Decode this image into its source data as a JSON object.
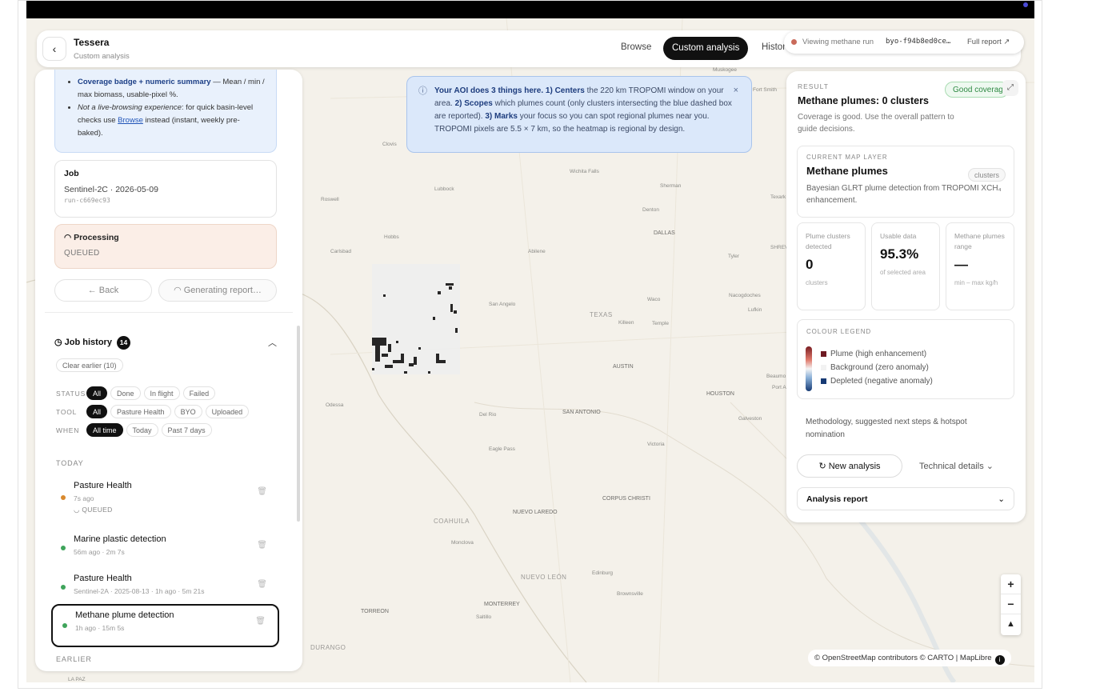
{
  "header": {
    "app_title": "Tessera",
    "app_subtitle": "Custom analysis",
    "nav_browse": "Browse",
    "nav_custom": "Custom analysis",
    "nav_history": "Histor",
    "run_label": "Viewing methane run",
    "run_id": "byo-f94b8ed0ce…",
    "full_report": "Full report ↗"
  },
  "left": {
    "info_line1_bold": "Coverage badge + numeric summary",
    "info_line1_rest": " — Mean / min / max biomass, usable-pixel %.",
    "info_line2_italic": "Not a live-browsing experience",
    "info_line2_rest": ": for quick basin-level checks use ",
    "info_line2_link": "Browse",
    "info_line2_tail": " instead (instant, weekly pre-baked).",
    "job_title": "Job",
    "job_sensor_date": "Sentinel-2C · 2026-05-09",
    "job_run": "run-c669ec93",
    "processing_title": "Processing",
    "processing_status": "QUEUED",
    "back_label": "← Back",
    "generating_label": "Generating report…",
    "history_title": "Job history",
    "history_count": "14",
    "clear_label": "Clear earlier (10)",
    "filters": {
      "status_label": "STATUS",
      "status": [
        "All",
        "Done",
        "In flight",
        "Failed"
      ],
      "tool_label": "TOOL",
      "tool": [
        "All",
        "Pasture Health",
        "BYO",
        "Uploaded"
      ],
      "when_label": "WHEN",
      "when": [
        "All time",
        "Today",
        "Past 7 days"
      ]
    },
    "section_today": "TODAY",
    "section_earlier": "EARLIER",
    "items": [
      {
        "name": "Pasture Health",
        "meta": "7s ago",
        "meta2": "QUEUED",
        "dot": "#d9892e"
      },
      {
        "name": "Marine plastic detection",
        "meta": "56m ago · 2m 7s",
        "dot": "#3fa45b"
      },
      {
        "name": "Pasture Health",
        "meta": "Sentinel-2A · 2025-08-13 · 1h ago · 5m 21s",
        "dot": "#3fa45b"
      },
      {
        "name": "Methane plume detection",
        "meta": "1h ago · 15m 5s",
        "dot": "#3fa45b"
      }
    ]
  },
  "banner": {
    "lead": "Your AOI does 3 things here. 1) Centers",
    "t1": " the 220 km TROPOMI window on your area. ",
    "b2": "2) Scopes",
    "t2": " which plumes count (only clusters intersecting the blue dashed box are reported). ",
    "b3": "3) Marks",
    "t3": " your focus so you can spot regional plumes near you. TROPOMI pixels are 5.5 × 7 km, so the heatmap is regional by design."
  },
  "right": {
    "kicker": "RESULT",
    "title": "Methane plumes: 0 clusters",
    "badge": "Good coverage",
    "desc": "Coverage is good. Use the overall pattern to guide decisions.",
    "layer_kicker": "CURRENT MAP LAYER",
    "layer_title": "Methane plumes",
    "layer_chip": "clusters",
    "layer_desc": "Bayesian GLRT plume detection from TROPOMI XCH₄ enhancement.",
    "stats": [
      {
        "label": "Plume clusters detected",
        "value": "0",
        "unit": "clusters"
      },
      {
        "label": "Usable data",
        "value": "95.3%",
        "unit": "of selected area"
      },
      {
        "label": "Methane plumes range",
        "value": "—",
        "unit": "min – max kg/h"
      }
    ],
    "legend_kicker": "COLOUR LEGEND",
    "legend": [
      {
        "label": "Plume (high enhancement)",
        "color": "#6e1a22"
      },
      {
        "label": "Background (zero anomaly)",
        "color": "#f2f2f2"
      },
      {
        "label": "Depleted (negative anomaly)",
        "color": "#173a74"
      }
    ],
    "methodology": "Methodology, suggested next steps & hotspot nomination",
    "new_analysis": "New analysis",
    "technical": "Technical details",
    "analysis_report": "Analysis report"
  },
  "map": {
    "attribution": "© OpenStreetMap contributors © CARTO | MapLibre",
    "labels": [
      "Muskogee",
      "Fort Smith",
      "Clovis",
      "Wichita Falls",
      "Lubbock",
      "Sherman",
      "Texark",
      "Roswell",
      "Denton",
      "Hobbs",
      "DALLAS",
      "Abilene",
      "Carlsbad",
      "Tyler",
      "SHREV",
      "Waco",
      "Nacogdoches",
      "San Angelo",
      "TEXAS",
      "Lufkin",
      "Killeen",
      "Temple",
      "AUSTIN",
      "Beaumo",
      "Port A",
      "HOUSTON",
      "Odessa",
      "Del Rio",
      "SAN ANTONIO",
      "Galveston",
      "Victoria",
      "Eagle Pass",
      "NUEVO LAREDO",
      "CORPUS CHRISTI",
      "COAHUILA",
      "Monclova",
      "NUEVO LEÓN",
      "Edinburg",
      "Brownsville",
      "MONTERREY",
      "TORREON",
      "Saltillo",
      "DURANGO",
      "LA PAZ"
    ]
  }
}
